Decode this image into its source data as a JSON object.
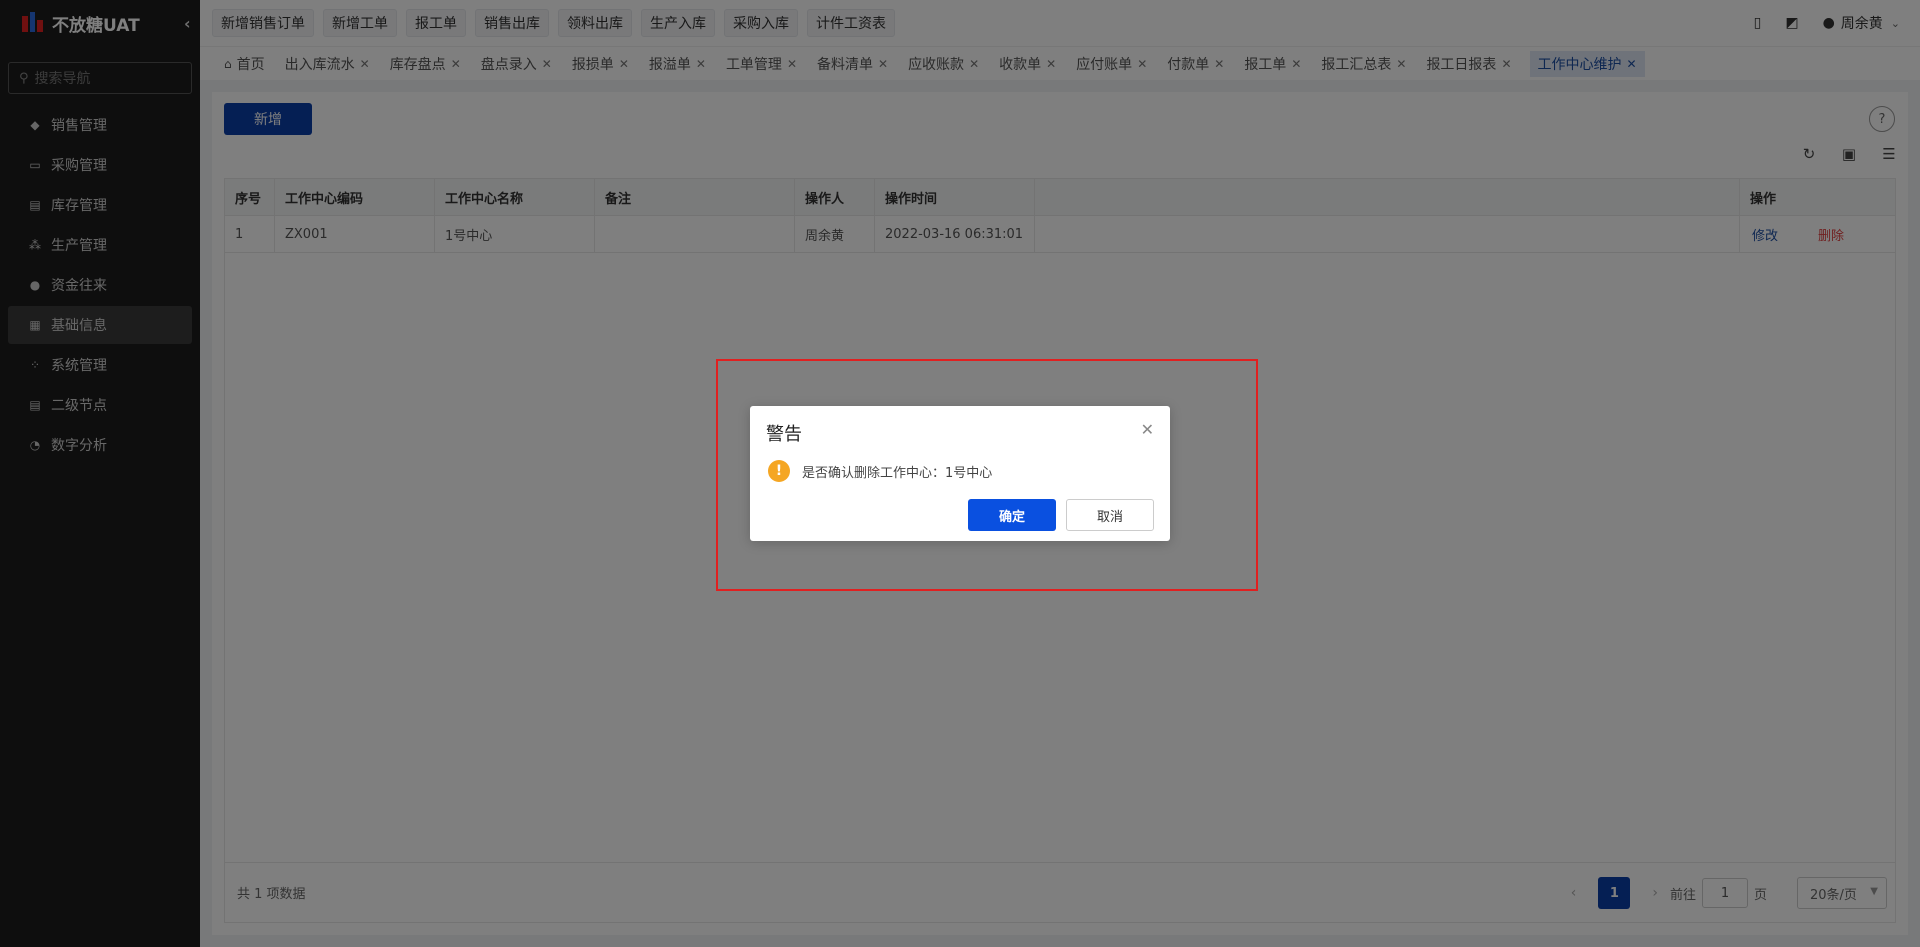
{
  "app": {
    "title": "不放糖UAT"
  },
  "sidebar": {
    "search_placeholder": "搜索导航",
    "items": [
      {
        "label": "销售管理",
        "icon": "tag-icon"
      },
      {
        "label": "采购管理",
        "icon": "cart-icon"
      },
      {
        "label": "库存管理",
        "icon": "box-icon"
      },
      {
        "label": "生产管理",
        "icon": "production-icon"
      },
      {
        "label": "资金往来",
        "icon": "money-icon"
      },
      {
        "label": "基础信息",
        "icon": "grid-icon",
        "active": true
      },
      {
        "label": "系统管理",
        "icon": "apps-icon"
      },
      {
        "label": "二级节点",
        "icon": "document-icon"
      },
      {
        "label": "数字分析",
        "icon": "pie-chart-icon"
      }
    ]
  },
  "topbar": {
    "quick_actions": [
      "新增销售订单",
      "新增工单",
      "报工单",
      "销售出库",
      "领料出库",
      "生产入库",
      "采购入库",
      "计件工资表"
    ],
    "user_name": "周余黄"
  },
  "tabs": [
    {
      "label": "首页",
      "closable": false
    },
    {
      "label": "出入库流水",
      "closable": true
    },
    {
      "label": "库存盘点",
      "closable": true
    },
    {
      "label": "盘点录入",
      "closable": true
    },
    {
      "label": "报损单",
      "closable": true
    },
    {
      "label": "报溢单",
      "closable": true
    },
    {
      "label": "工单管理",
      "closable": true
    },
    {
      "label": "备料清单",
      "closable": true
    },
    {
      "label": "应收账款",
      "closable": true
    },
    {
      "label": "收款单",
      "closable": true
    },
    {
      "label": "应付账单",
      "closable": true
    },
    {
      "label": "付款单",
      "closable": true
    },
    {
      "label": "报工单",
      "closable": true
    },
    {
      "label": "报工汇总表",
      "closable": true
    },
    {
      "label": "报工日报表",
      "closable": true
    },
    {
      "label": "工作中心维护",
      "closable": true,
      "active": true
    }
  ],
  "page": {
    "add_label": "新增",
    "table": {
      "headers": [
        "序号",
        "工作中心编码",
        "工作中心名称",
        "备注",
        "操作人",
        "操作时间",
        "",
        "操作"
      ],
      "rows": [
        {
          "index": "1",
          "code": "ZX001",
          "name": "1号中心",
          "note": "",
          "operator": "周余黄",
          "time": "2022-03-16 06:31:01",
          "edit": "修改",
          "delete": "删除"
        }
      ]
    },
    "footer": {
      "total": "共 1 项数据",
      "current_page": "1",
      "goto_label": "前往",
      "goto_value": "1",
      "page_unit": "页",
      "page_size": "20条/页"
    }
  },
  "dialog": {
    "title": "警告",
    "message": "是否确认删除工作中心：1号中心",
    "confirm": "确定",
    "cancel": "取消"
  },
  "colors": {
    "primary": "#0a3ea8",
    "danger": "#e04040",
    "warning": "#f5a623",
    "highlight": "#e02020"
  }
}
